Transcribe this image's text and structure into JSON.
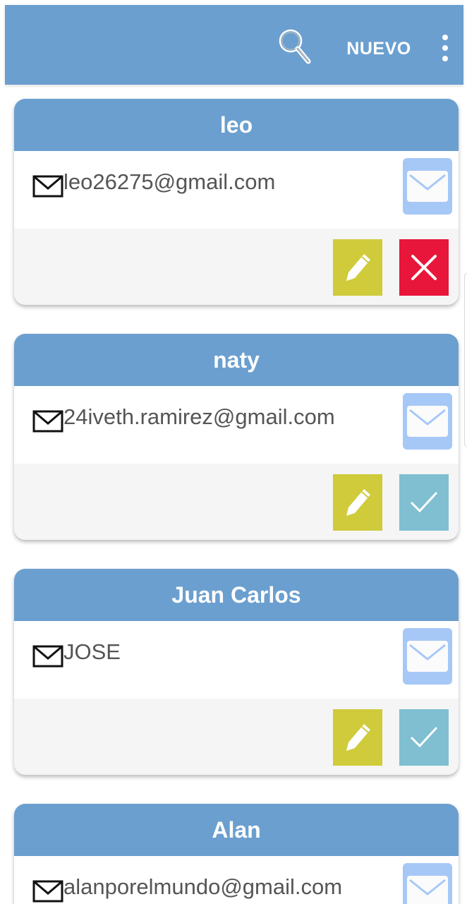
{
  "app_bar": {
    "new_label": "NUEVO",
    "color": "#6b9fcf",
    "icons": [
      "search-icon",
      "more-vert-icon"
    ]
  },
  "contacts": [
    {
      "name": "leo",
      "email": "leo26275@gmail.com",
      "status_action": "delete",
      "status_color": "#e8163a"
    },
    {
      "name": "naty",
      "email": "24iveth.ramirez@gmail.com",
      "status_action": "confirm",
      "status_color": "#7fbfd1"
    },
    {
      "name": "Juan Carlos",
      "email": "JOSE",
      "status_action": "confirm",
      "status_color": "#7fbfd1"
    },
    {
      "name": "Alan",
      "email": "alanporelmundo@gmail.com"
    }
  ],
  "colors": {
    "header": "#6b9fcf",
    "mail_button": "#a6c8f7",
    "edit_button": "#cfcb3b"
  }
}
